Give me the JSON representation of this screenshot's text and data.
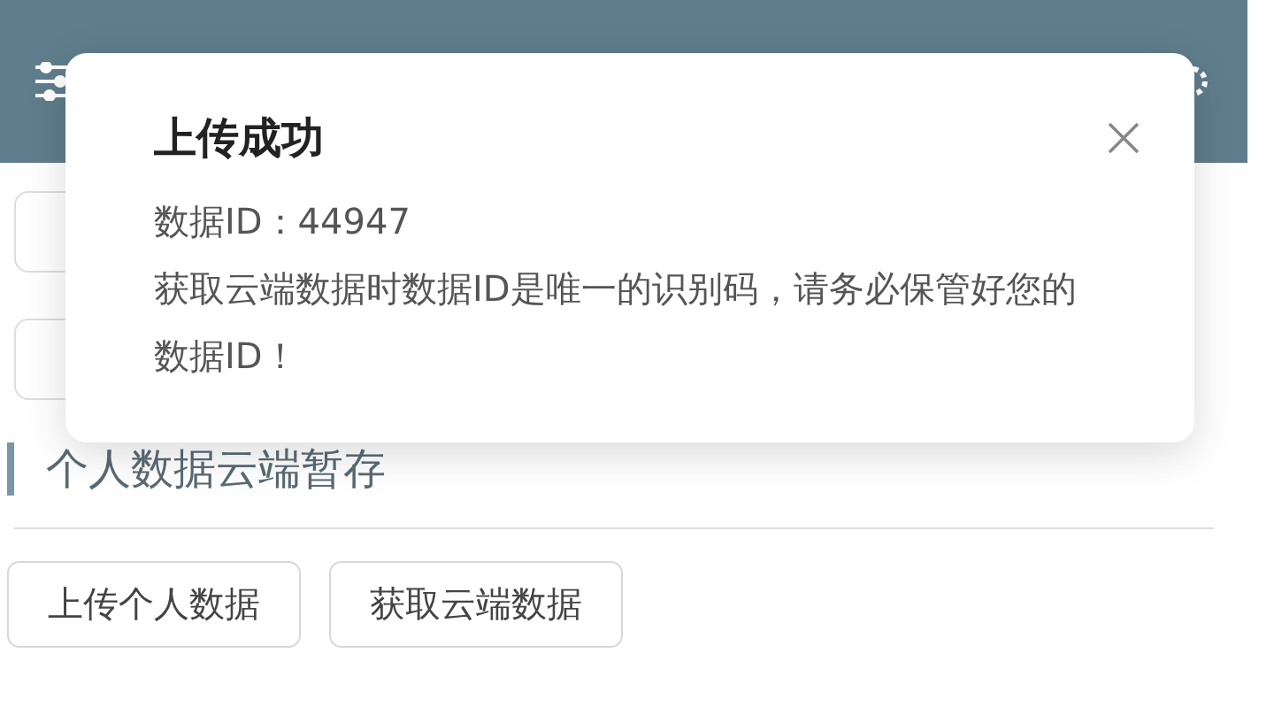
{
  "dialog": {
    "title": "上传成功",
    "lines": [
      "数据ID：44947",
      "获取云端数据时数据ID是唯一的识别码，请务必保管好您的数据ID！"
    ]
  },
  "section": {
    "title": "个人数据云端暂存",
    "buttons": [
      "上传个人数据",
      "获取云端数据"
    ]
  }
}
